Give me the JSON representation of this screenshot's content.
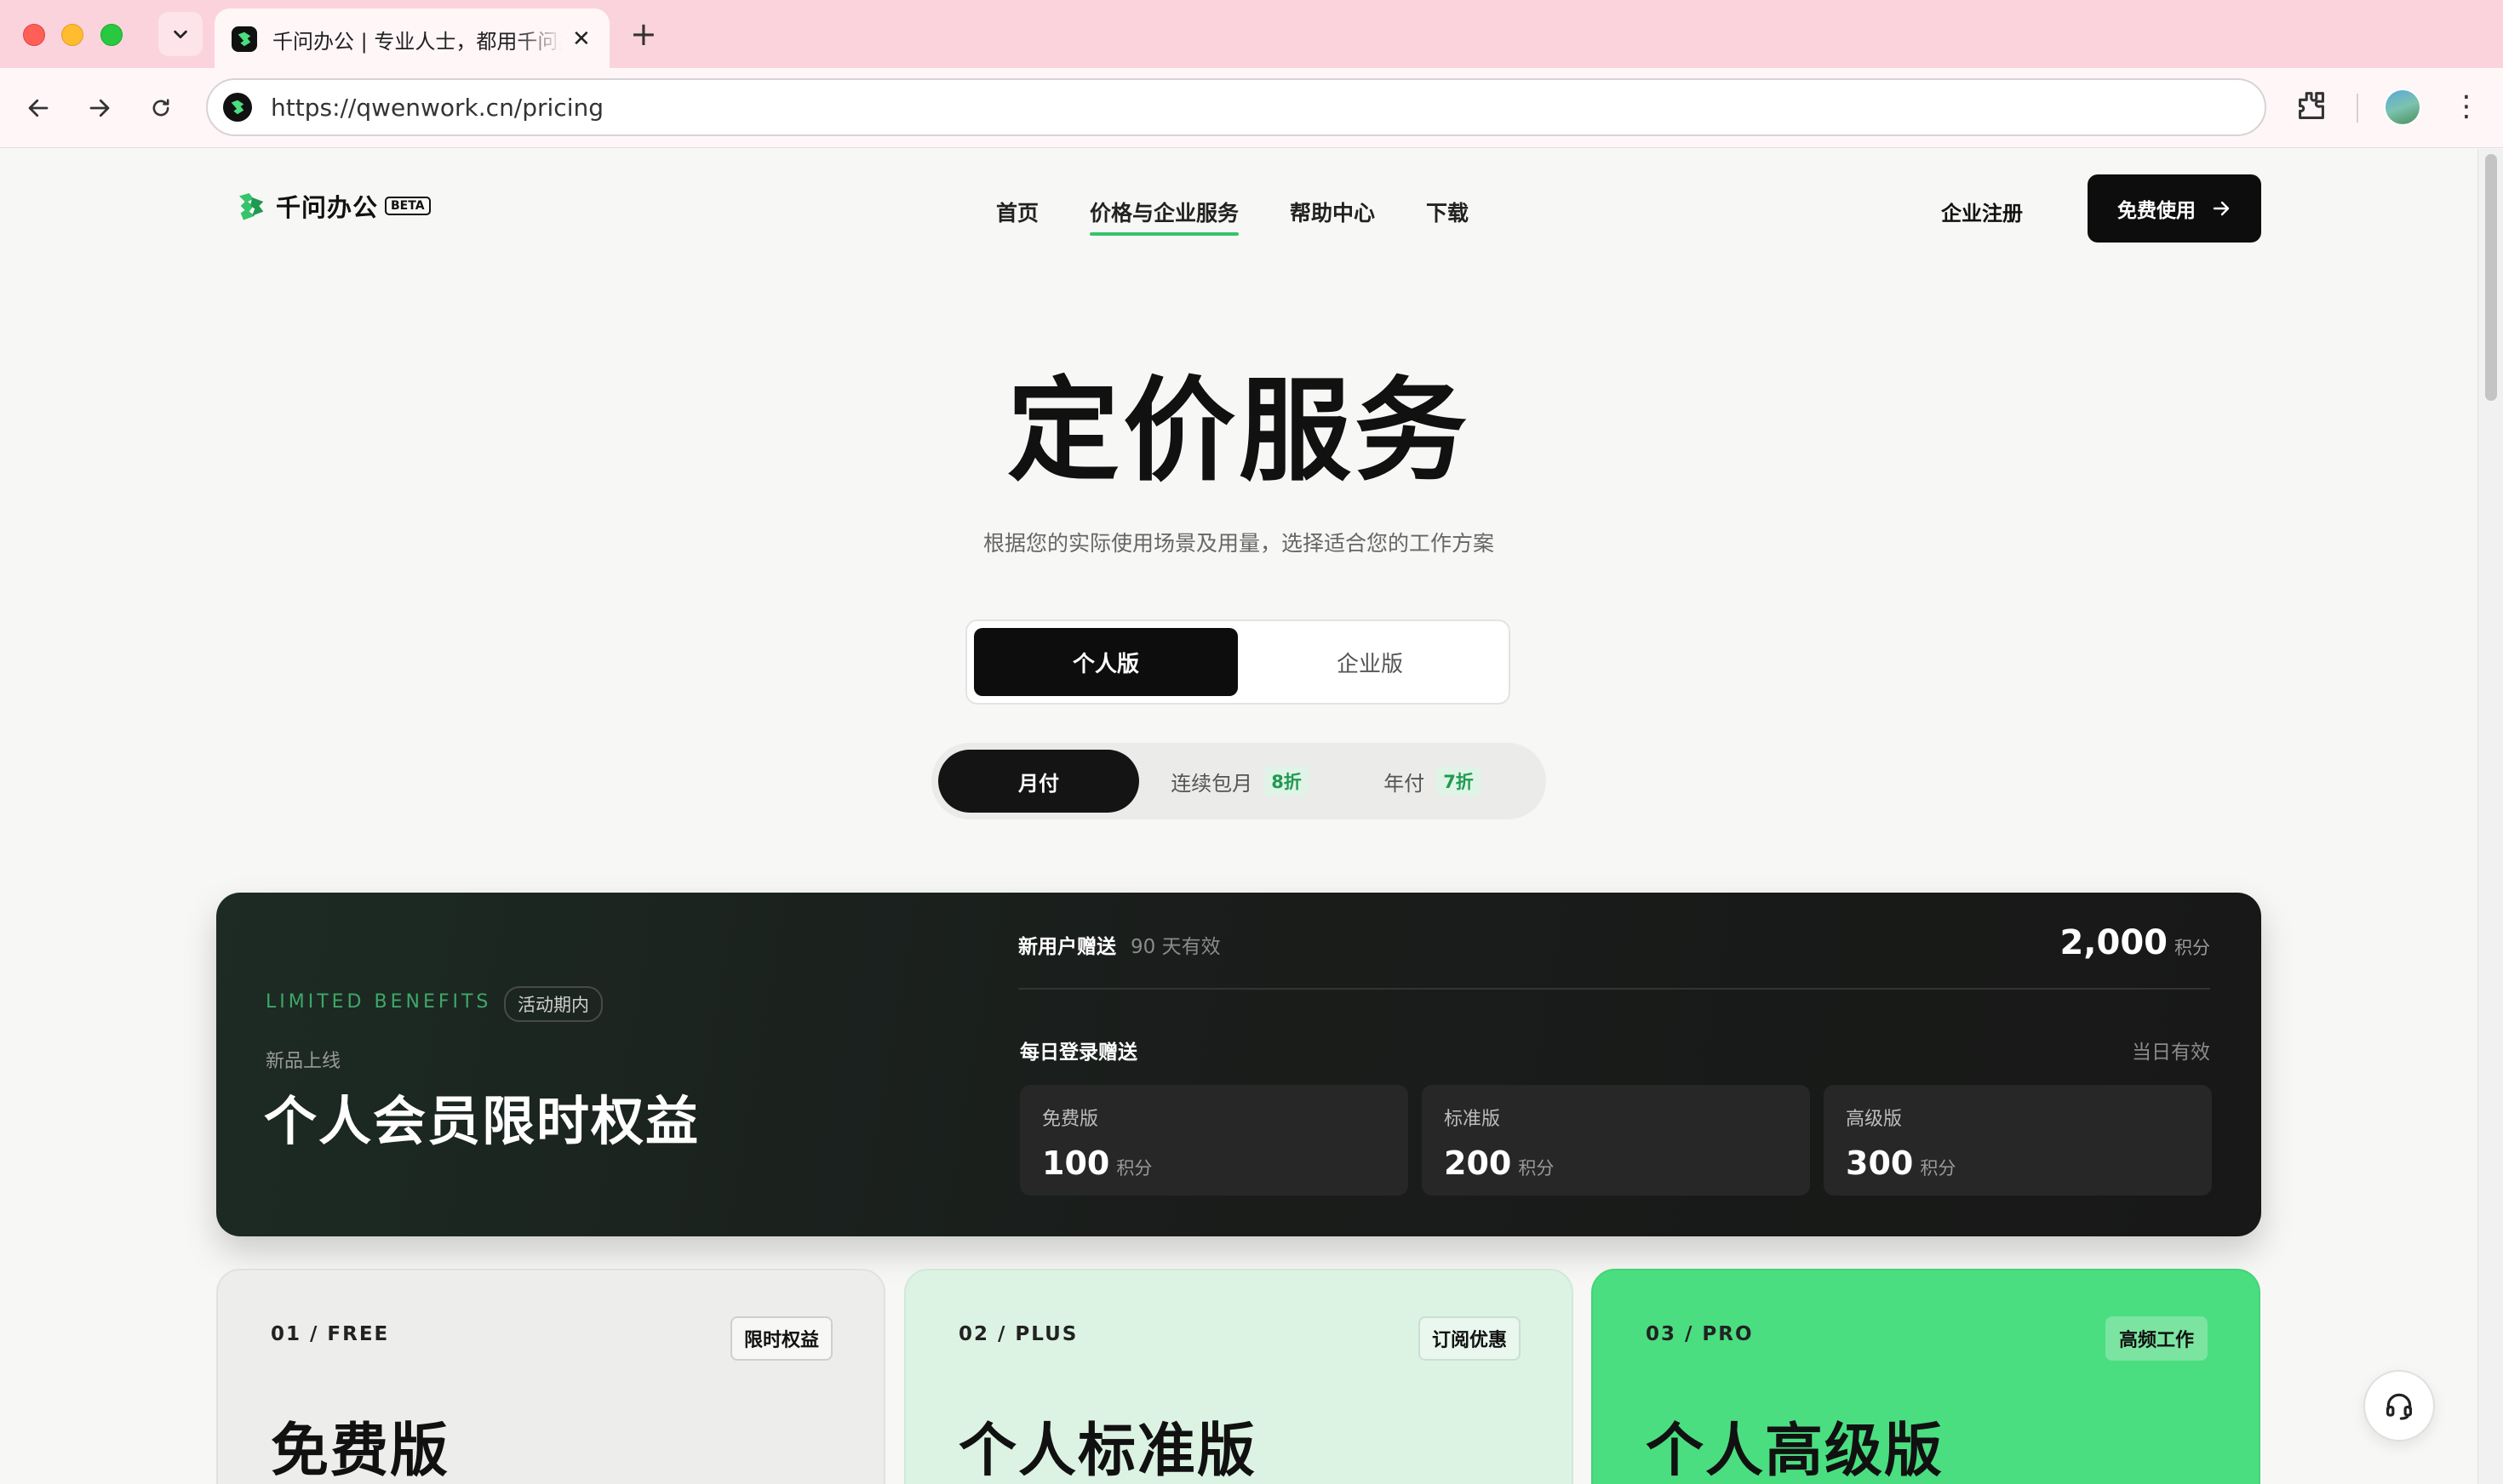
{
  "browser": {
    "tab_title": "千问办公 | 专业人士，都用千问办公",
    "url": "https://qwenwork.cn/pricing",
    "new_tab": "+",
    "close": "✕",
    "more": "⋮"
  },
  "header": {
    "logo_text": "千问办公",
    "beta": "BETA",
    "nav": [
      {
        "label": "首页"
      },
      {
        "label": "价格与企业服务",
        "active": true
      },
      {
        "label": "帮助中心"
      },
      {
        "label": "下载"
      }
    ],
    "signup": "企业注册",
    "cta": "免费使用"
  },
  "hero": {
    "title": "定价服务",
    "subtitle": "根据您的实际使用场景及用量，选择适合您的工作方案"
  },
  "edition_toggle": {
    "options": [
      "个人版",
      "企业版"
    ],
    "selected": "个人版"
  },
  "billing_toggle": {
    "options": [
      {
        "label": "月付",
        "discount": ""
      },
      {
        "label": "连续包月",
        "discount": "8折"
      },
      {
        "label": "年付",
        "discount": "7折"
      }
    ],
    "selected": "月付"
  },
  "benefits": {
    "eyebrow": "LIMITED BENEFITS",
    "badge": "活动期内",
    "new": "新品上线",
    "title": "个人会员限时权益",
    "new_user": {
      "label": "新用户赠送",
      "validity": "90 天有效",
      "amount": "2,000",
      "unit": "积分"
    },
    "daily": {
      "label": "每日登录赠送",
      "validity": "当日有效",
      "tiers": [
        {
          "name": "免费版",
          "value": "100",
          "unit": "积分"
        },
        {
          "name": "标准版",
          "value": "200",
          "unit": "积分"
        },
        {
          "name": "高级版",
          "value": "300",
          "unit": "积分"
        }
      ]
    }
  },
  "plans": [
    {
      "num": "01 / FREE",
      "tag": "限时权益",
      "name": "免费版"
    },
    {
      "num": "02 / PLUS",
      "tag": "订阅优惠",
      "name": "个人标准版"
    },
    {
      "num": "03 / PRO",
      "tag": "高频工作",
      "name": "个人高级版"
    }
  ],
  "colors": {
    "accent": "#35c46c",
    "pro_card": "#4ade80",
    "plus_card": "#dcf3e3",
    "dark": "#0d0d0d"
  }
}
